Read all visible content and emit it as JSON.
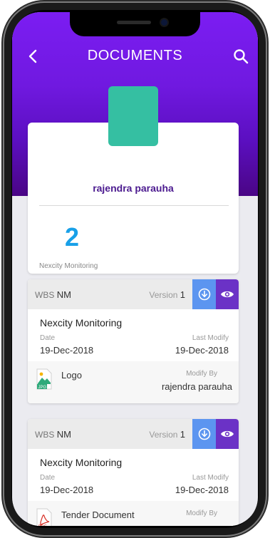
{
  "header": {
    "title": "DOCUMENTS"
  },
  "profile": {
    "name": "rajendra parauha",
    "count": "2",
    "count_label": "Nexcity Monitoring"
  },
  "documents": [
    {
      "wbs_label": "WBS",
      "wbs_value": "NM",
      "version_label": "Version",
      "version_value": "1",
      "title": "Nexcity Monitoring",
      "date_label": "Date",
      "date_value": "19-Dec-2018",
      "modify_label": "Last Modify",
      "modify_value": "19-Dec-2018",
      "file_name": "Logo",
      "file_type": "JPG",
      "modified_by_label": "Modify By",
      "modified_by_value": "rajendra parauha"
    },
    {
      "wbs_label": "WBS",
      "wbs_value": "NM",
      "version_label": "Version",
      "version_value": "1",
      "title": "Nexcity Monitoring",
      "date_label": "Date",
      "date_value": "19-Dec-2018",
      "modify_label": "Last Modify",
      "modify_value": "19-Dec-2018",
      "file_name": "Tender Document",
      "file_type": "PDF",
      "modified_by_label": "Modify By",
      "modified_by_value": ""
    }
  ],
  "colors": {
    "header_top": "#7b1df2",
    "header_bottom": "#4a0585",
    "count": "#18a0e8",
    "download_btn": "#5c95f0",
    "view_btn": "#6b32c6",
    "avatar": "#35bfa2"
  },
  "icons": {
    "back": "chevron-left-icon",
    "search": "search-icon",
    "download": "download-icon",
    "view": "eye-icon",
    "jpg_file": "image-file-icon",
    "pdf_file": "pdf-file-icon"
  }
}
